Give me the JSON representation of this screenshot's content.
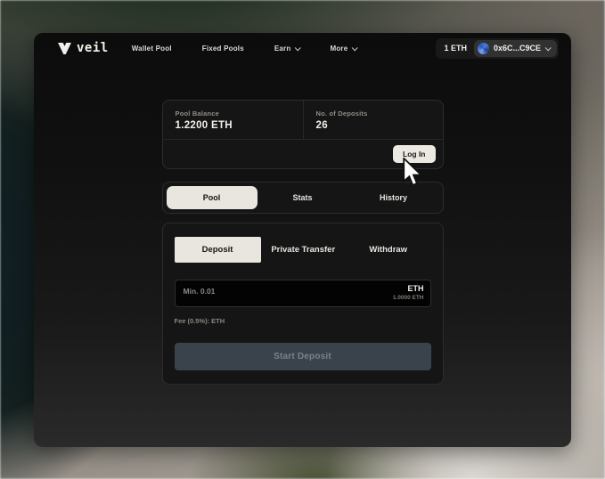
{
  "nav": {
    "logo_text": "veil",
    "items": [
      {
        "label": "Wallet Pool"
      },
      {
        "label": "Fixed Pools"
      },
      {
        "label": "Earn"
      },
      {
        "label": "More"
      }
    ],
    "wallet": {
      "balance": "1 ETH",
      "address": "0x6C...C9CE"
    }
  },
  "stats_card": {
    "pool_balance_label": "Pool Balance",
    "pool_balance_value": "1.2200 ETH",
    "deposits_label": "No. of Deposits",
    "deposits_value": "26",
    "login_label": "Log In"
  },
  "view_tabs": [
    {
      "label": "Pool",
      "active": true
    },
    {
      "label": "Stats",
      "active": false
    },
    {
      "label": "History",
      "active": false
    }
  ],
  "action_tabs": [
    {
      "label": "Deposit",
      "active": true
    },
    {
      "label": "Private Transfer",
      "active": false
    },
    {
      "label": "Withdraw",
      "active": false
    }
  ],
  "deposit_form": {
    "amount_placeholder": "Min. 0.01",
    "currency": "ETH",
    "available_balance": "1.0000 ETH",
    "fee_text": "Fee (0.5%): ETH",
    "submit_label": "Start Deposit"
  },
  "colors": {
    "accent_cream": "#e9e6e0",
    "window_top": "#0c0c0c",
    "window_bottom": "#2a2a2a",
    "submit_bg": "#3a424c",
    "identicon_blue": "#4a7fd4"
  }
}
